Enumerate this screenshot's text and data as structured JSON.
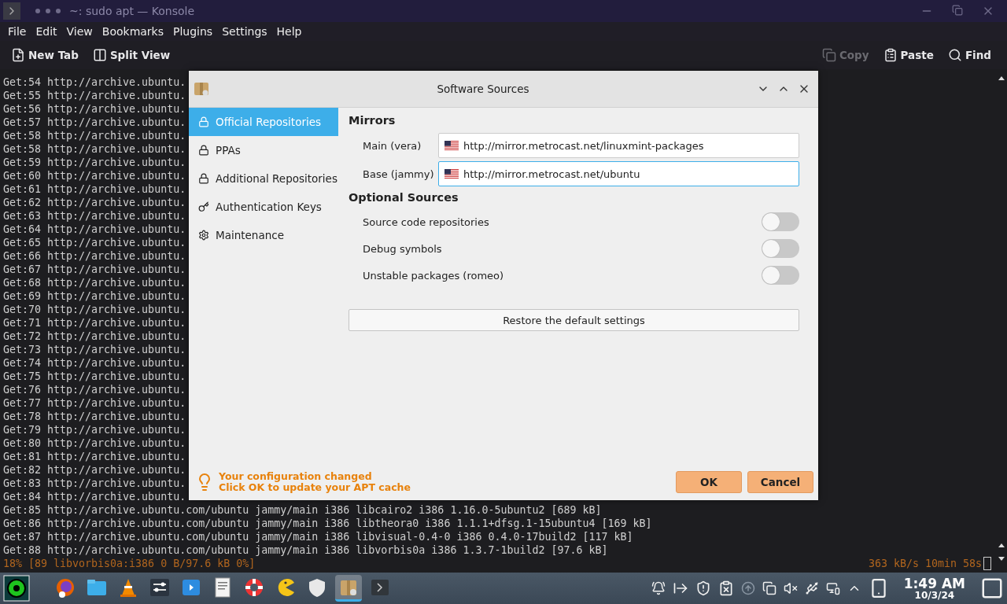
{
  "window": {
    "title": "~: sudo apt — Konsole"
  },
  "menu": [
    "File",
    "Edit",
    "View",
    "Bookmarks",
    "Plugins",
    "Settings",
    "Help"
  ],
  "toolbar": {
    "left": [
      {
        "label": "New Tab",
        "kind": "newtab",
        "disabled": false
      },
      {
        "label": "Split View",
        "kind": "split",
        "disabled": false
      }
    ],
    "right": [
      {
        "label": "Copy",
        "kind": "copy",
        "disabled": true
      },
      {
        "label": "Paste",
        "kind": "paste",
        "disabled": false
      },
      {
        "label": "Find",
        "kind": "find",
        "disabled": false
      }
    ]
  },
  "terminal": {
    "lines": [
      "Get:54 http://archive.ubuntu.",
      "Get:55 http://archive.ubuntu.",
      "Get:56 http://archive.ubuntu.",
      "Get:57 http://archive.ubuntu.",
      "Get:58 http://archive.ubuntu.",
      "Get:58 http://archive.ubuntu.",
      "Get:59 http://archive.ubuntu.",
      "Get:60 http://archive.ubuntu.",
      "Get:61 http://archive.ubuntu.",
      "Get:62 http://archive.ubuntu.",
      "Get:63 http://archive.ubuntu.",
      "Get:64 http://archive.ubuntu.",
      "Get:65 http://archive.ubuntu.",
      "Get:66 http://archive.ubuntu.",
      "Get:67 http://archive.ubuntu.",
      "Get:68 http://archive.ubuntu.",
      "Get:69 http://archive.ubuntu.",
      "Get:70 http://archive.ubuntu.",
      "Get:71 http://archive.ubuntu.",
      "Get:72 http://archive.ubuntu.",
      "Get:73 http://archive.ubuntu.",
      "Get:74 http://archive.ubuntu.",
      "Get:75 http://archive.ubuntu.",
      "Get:76 http://archive.ubuntu.",
      "Get:77 http://archive.ubuntu.",
      "Get:78 http://archive.ubuntu.",
      "Get:79 http://archive.ubuntu.",
      "Get:80 http://archive.ubuntu.",
      "Get:81 http://archive.ubuntu.",
      "Get:82 http://archive.ubuntu.",
      "Get:83 http://archive.ubuntu.",
      "Get:84 http://archive.ubuntu.",
      "Get:85 http://archive.ubuntu.com/ubuntu jammy/main i386 libcairo2 i386 1.16.0-5ubuntu2 [689 kB]",
      "Get:86 http://archive.ubuntu.com/ubuntu jammy/main i386 libtheora0 i386 1.1.1+dfsg.1-15ubuntu4 [169 kB]",
      "Get:87 http://archive.ubuntu.com/ubuntu jammy/main i386 libvisual-0.4-0 i386 0.4.0-17build2 [117 kB]",
      "Get:88 http://archive.ubuntu.com/ubuntu jammy/main i386 libvorbis0a i386 1.3.7-1build2 [97.6 kB]"
    ],
    "progress": "18% [89 libvorbis0a:i386 0 B/97.6 kB 0%]",
    "rate": "363 kB/s 10min 58s"
  },
  "dialog": {
    "title": "Software Sources",
    "sidebar": [
      {
        "label": "Official Repositories",
        "kind": "lock",
        "selected": true
      },
      {
        "label": "PPAs",
        "kind": "lock",
        "selected": false
      },
      {
        "label": "Additional Repositories",
        "kind": "lock",
        "selected": false
      },
      {
        "label": "Authentication Keys",
        "kind": "key",
        "selected": false
      },
      {
        "label": "Maintenance",
        "kind": "gear",
        "selected": false
      }
    ],
    "mirrors": {
      "heading": "Mirrors",
      "rows": [
        {
          "label": "Main (vera)",
          "value": "http://mirror.metrocast.net/linuxmint-packages",
          "focused": false
        },
        {
          "label": "Base (jammy)",
          "value": "http://mirror.metrocast.net/ubuntu",
          "focused": true
        }
      ]
    },
    "optional": {
      "heading": "Optional Sources",
      "rows": [
        {
          "label": "Source code repositories",
          "on": false
        },
        {
          "label": "Debug symbols",
          "on": false
        },
        {
          "label": "Unstable packages (romeo)",
          "on": false
        }
      ]
    },
    "restore_button": "Restore the default settings",
    "notice": {
      "title": "Your configuration changed",
      "text": "Click OK to update your APT cache"
    },
    "buttons": [
      "OK",
      "Cancel"
    ]
  },
  "taskbar": {
    "apps": [
      {
        "kind": "firefox",
        "selected": false
      },
      {
        "kind": "files",
        "selected": false
      },
      {
        "kind": "vlc",
        "selected": false
      },
      {
        "kind": "settings",
        "selected": false
      },
      {
        "kind": "store",
        "selected": false
      },
      {
        "kind": "document",
        "selected": false
      },
      {
        "kind": "help",
        "selected": false
      },
      {
        "kind": "pacman",
        "selected": false
      },
      {
        "kind": "shield",
        "selected": false
      },
      {
        "kind": "package",
        "selected": true
      },
      {
        "kind": "terminal",
        "selected": false
      }
    ],
    "time": "1:49 AM",
    "date": "10/3/24"
  }
}
